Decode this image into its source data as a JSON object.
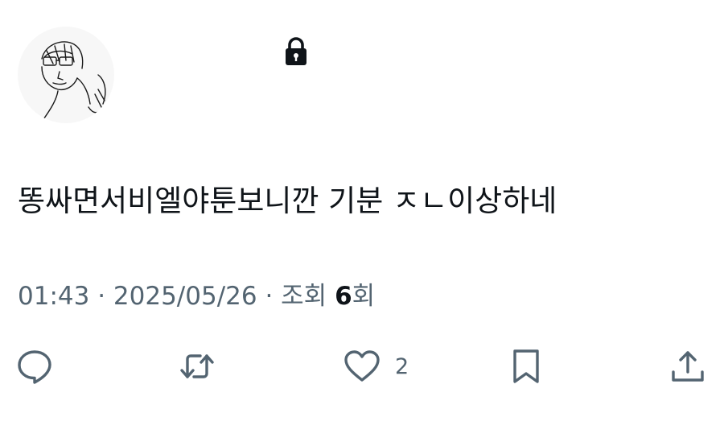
{
  "profile": {
    "avatar_icon": "sketch-portrait-avatar"
  },
  "lock_icon": "lock-icon",
  "tweet": {
    "text": "똥싸면서비엘야툰보니깐 기분 ㅈㄴ이상하네"
  },
  "meta": {
    "time": "01:43",
    "separator": " · ",
    "date": "2025/05/26",
    "views_prefix": "조회 ",
    "views_count": "6",
    "views_suffix": "회"
  },
  "actions": {
    "reply": {
      "icon": "reply-icon"
    },
    "retweet": {
      "icon": "retweet-icon"
    },
    "like": {
      "icon": "heart-icon",
      "count": "2"
    },
    "bookmark": {
      "icon": "bookmark-icon"
    },
    "share": {
      "icon": "share-icon"
    }
  },
  "colors": {
    "text": "#0f1419",
    "secondary": "#536471"
  }
}
